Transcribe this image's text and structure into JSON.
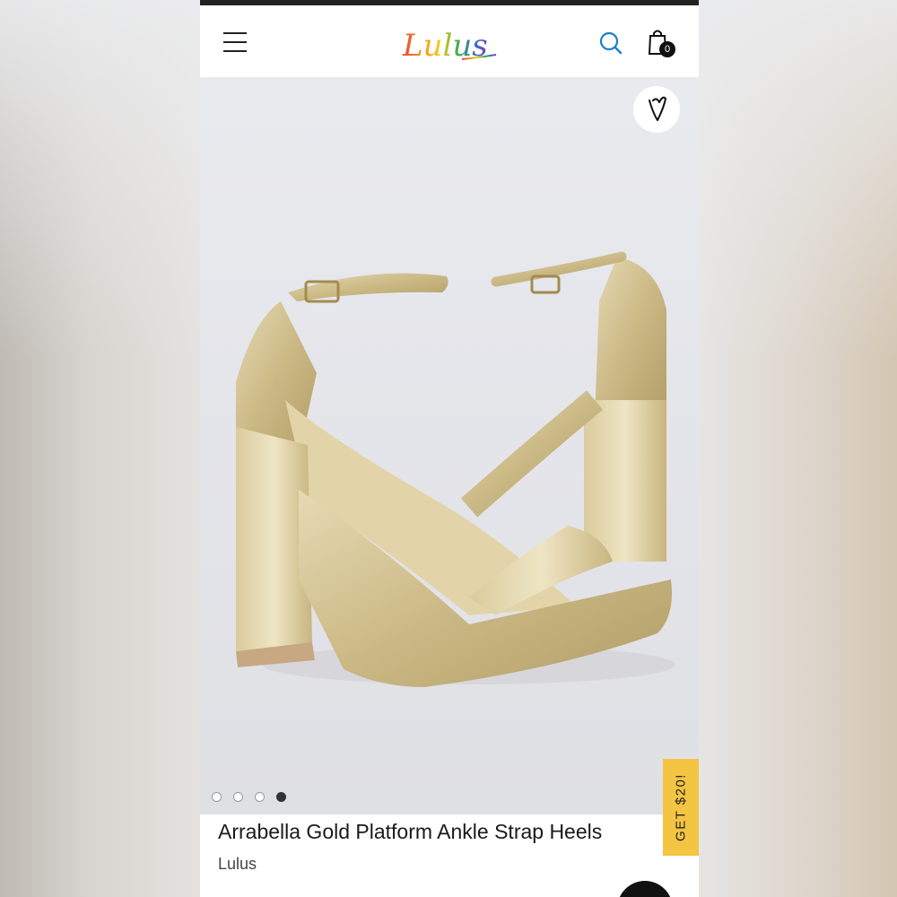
{
  "header": {
    "logo_text": "Lulus",
    "cart_count": "0",
    "icons": {
      "menu": "hamburger-menu-icon",
      "search": "search-icon",
      "cart": "shopping-bag-icon"
    }
  },
  "gallery": {
    "total_images": 4,
    "active_index": 4,
    "favorite_icon": "heart-icon"
  },
  "promo": {
    "label": "GET $20!",
    "color": "#f4c542"
  },
  "product": {
    "title": "Arrabella Gold Platform Ankle Strap Heels",
    "brand": "Lulus"
  },
  "colors": {
    "accent_search": "#1a7fc9",
    "promo": "#f4c542",
    "shoe_gold": "#cbb985"
  }
}
